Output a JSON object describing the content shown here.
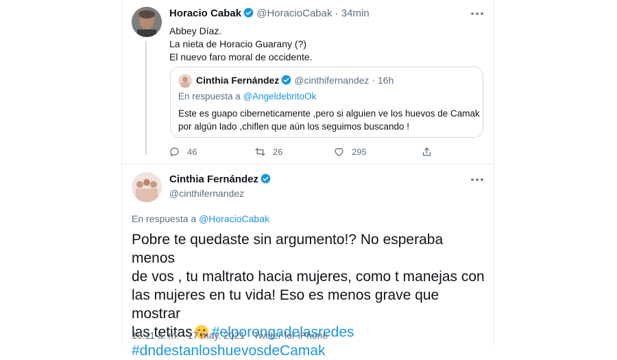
{
  "tweet1": {
    "author_name": "Horacio Cabak",
    "handle": "@HoracioCabak",
    "time_sep": "·",
    "time": "34min",
    "lines": [
      "Abbey Díaz.",
      "La nieta de Horacio Guarany (?)",
      "El nuevo faro moral de occidente."
    ],
    "quote": {
      "author_name": "Cinthia Fernández",
      "handle": "@cinthifernandez",
      "time_sep": "·",
      "time": "16h",
      "reply_prefix": "En respuesta a",
      "reply_to": "@AngeldebritoOk",
      "lines": [
        "Este es guapo ciberneticamente ,pero si alguien ve los huevos de Camak",
        "por algún lado ,chiflen que aún los seguimos buscando !"
      ]
    },
    "actions": {
      "replies": "46",
      "retweets": "26",
      "likes": "295"
    }
  },
  "tweet2": {
    "author_name": "Cinthia Fernández",
    "handle": "@cinthifernandez",
    "reply_prefix": "En respuesta a",
    "reply_to": "@HoracioCabak",
    "text_lines": [
      "Pobre te quedaste sin argumento!? No esperaba menos",
      "de vos , tu maltrato hacia mujeres, como t manejas con",
      "las mujeres en tu vida! Eso es menos grave que mostrar",
      "las tetitas"
    ],
    "hashtags": [
      "#elporongadelasredes",
      "#dndestanloshuevosdeCamak"
    ],
    "timestamp": "10:11 a. m. · 17 may. 2021 · Twitter for iPhone"
  },
  "colors": {
    "accent": "#1b95e0",
    "muted": "#5b7083",
    "border": "#cfd9de",
    "text": "#0f1419"
  },
  "icons": [
    "verified-badge-icon",
    "more-options-icon",
    "reply-icon",
    "retweet-icon",
    "like-icon",
    "share-icon",
    "kiss-emoji-icon"
  ]
}
